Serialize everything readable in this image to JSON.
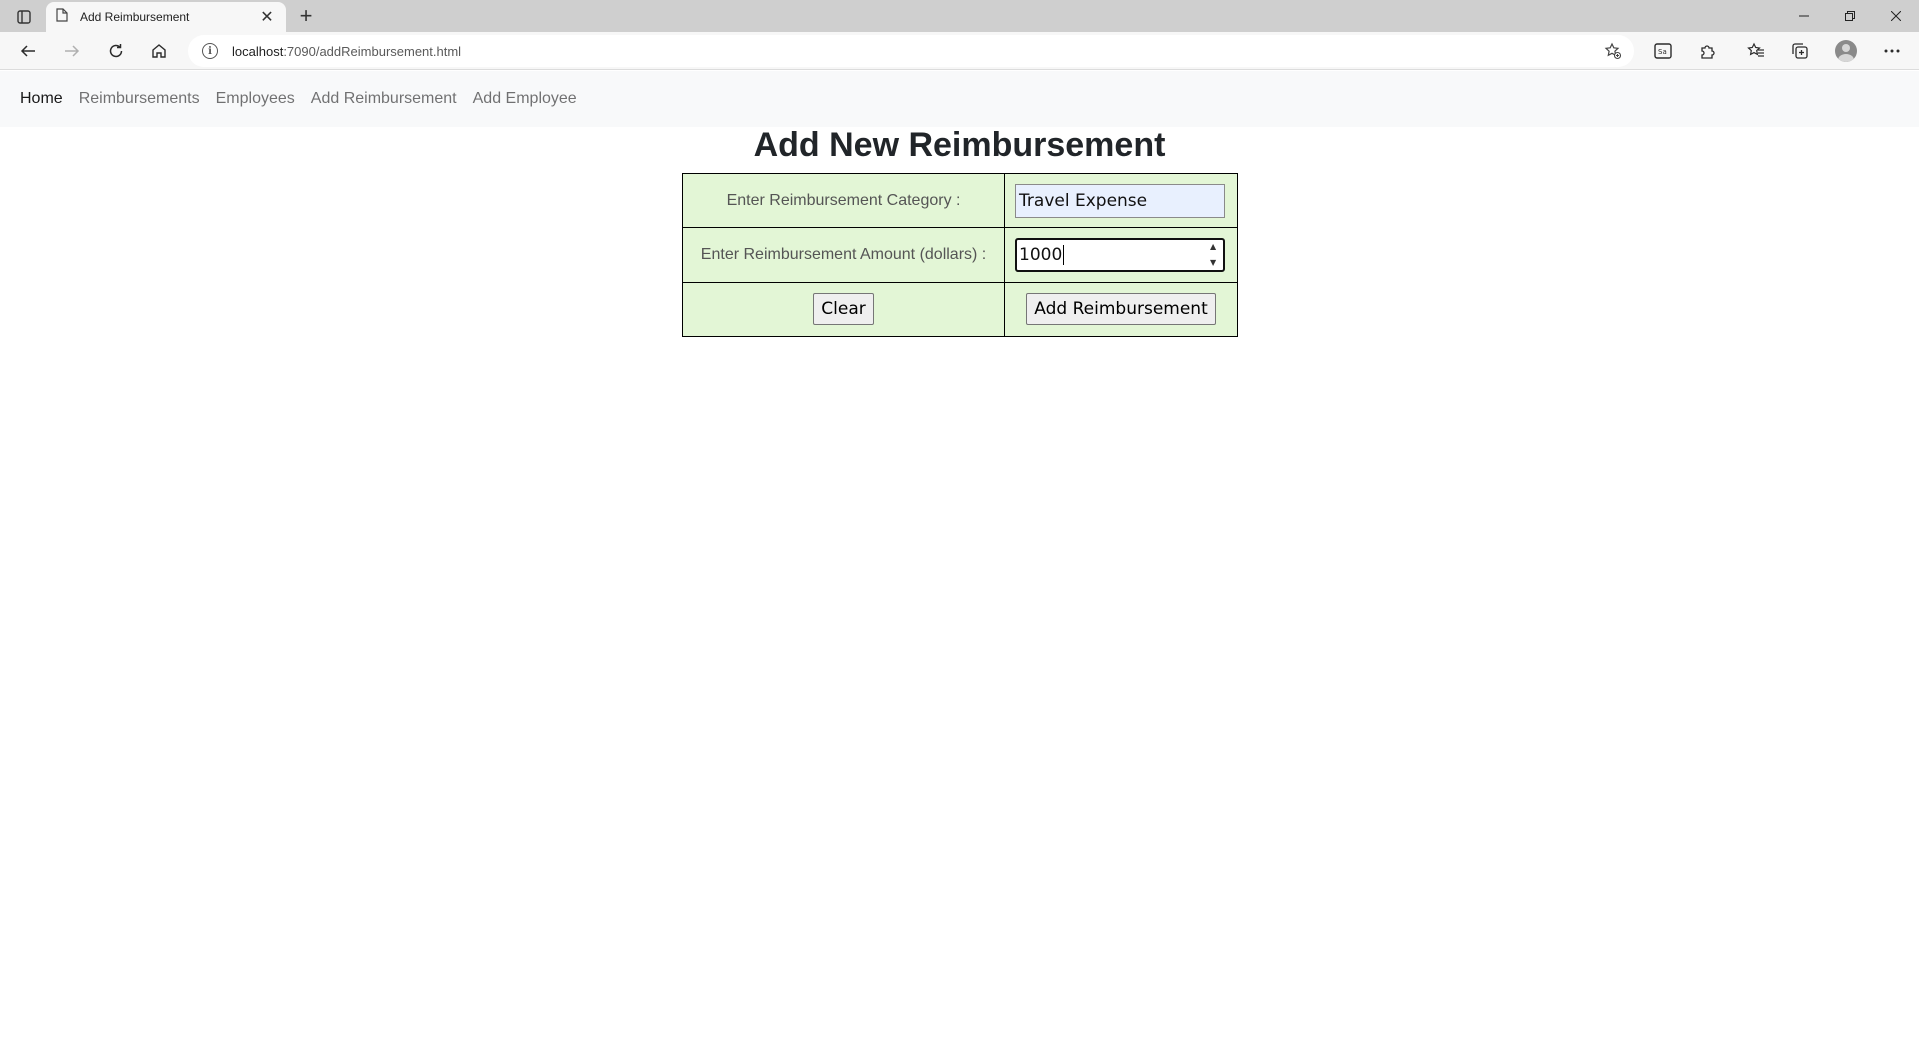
{
  "browser": {
    "tab_title": "Add Reimbursement",
    "url_host": "localhost",
    "url_path": ":7090/addReimbursement.html"
  },
  "nav": {
    "items": [
      {
        "label": "Home",
        "active": true
      },
      {
        "label": "Reimbursements",
        "active": false
      },
      {
        "label": "Employees",
        "active": false
      },
      {
        "label": "Add Reimbursement",
        "active": false
      },
      {
        "label": "Add Employee",
        "active": false
      }
    ]
  },
  "page": {
    "title": "Add New Reimbursement"
  },
  "form": {
    "category_label": "Enter Reimbursement Category :",
    "category_value": "Travel Expense",
    "amount_label": "Enter Reimbursement Amount (dollars) :",
    "amount_value": "1000",
    "clear_label": "Clear",
    "submit_label": "Add Reimbursement"
  },
  "colors": {
    "form_background": "#e3f6d6",
    "navbar_background": "#f8f9fa",
    "autofill_background": "#e8f0fe"
  }
}
